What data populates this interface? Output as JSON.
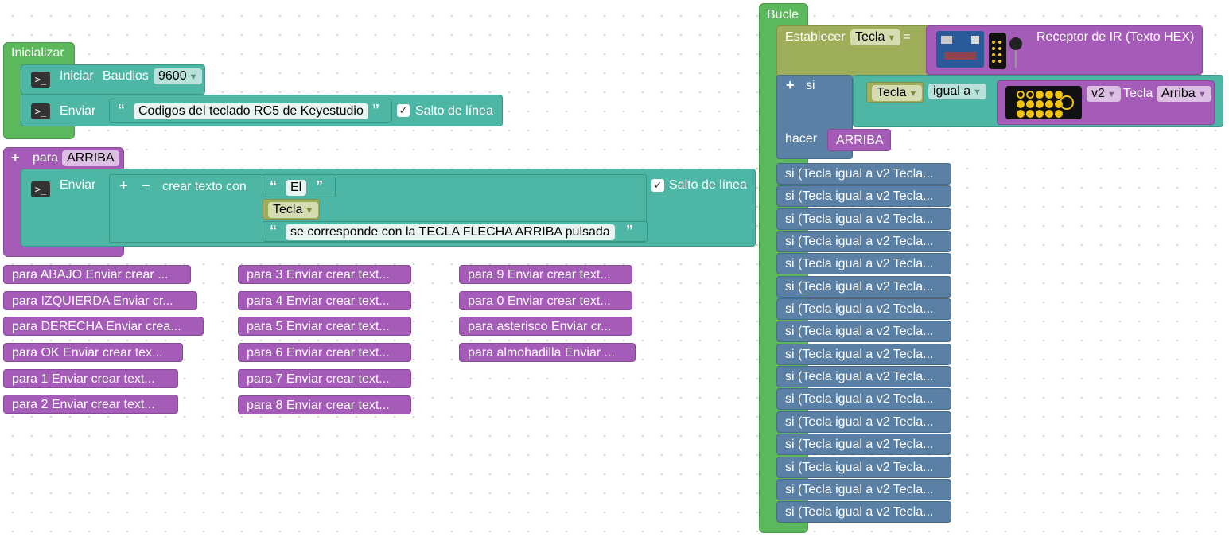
{
  "init_block": {
    "label": "Inicializar",
    "serial_begin": {
      "label": "Iniciar",
      "baud_label": "Baudios",
      "baud_value": "9600"
    },
    "serial_print": {
      "label": "Enviar",
      "text": "Codigos del teclado RC5 de Keyestudio",
      "newline_label": "Salto de línea"
    }
  },
  "func_arriba": {
    "label": "para",
    "name": "ARRIBA",
    "print_label": "Enviar",
    "join_label": "crear texto con",
    "item1": "El",
    "item2_var": "Tecla",
    "item3": "se corresponde con la TECLA FLECHA ARRIBA pulsada",
    "newline_label": "Salto de línea"
  },
  "collapsed_funcs": {
    "col1": [
      "para ABAJO  Enviar   crear ...",
      "para IZQUIERDA  Enviar   cr...",
      "para DERECHA  Enviar   crea...",
      "para OK  Enviar   crear tex...",
      "para 1  Enviar   crear text...",
      "para 2  Enviar   crear text..."
    ],
    "col2": [
      "para 3  Enviar   crear text...",
      "para 4  Enviar   crear text...",
      "para 5  Enviar   crear text...",
      "para 6  Enviar   crear text...",
      "para 7  Enviar   crear text...",
      "para 8  Enviar   crear text..."
    ],
    "col3": [
      "para 9  Enviar   crear text...",
      "para 0  Enviar   crear text...",
      "para asterisco  Enviar   cr...",
      "para almohadilla  Enviar   ..."
    ]
  },
  "loop_block": {
    "label": "Bucle",
    "set_label": "Establecer",
    "set_var": "Tecla",
    "eq": "=",
    "ir_label": "Receptor de IR (Texto HEX)",
    "if_label": "si",
    "do_label": "hacer",
    "cond_var": "Tecla",
    "cond_op": "igual a",
    "remote_version": "v2",
    "remote_key_label": "Tecla",
    "remote_key": "Arriba",
    "call_name": "ARRIBA",
    "collapsed_ifs": [
      "si (Tecla igual a  v2 Tecla...",
      "si (Tecla igual a  v2 Tecla...",
      "si (Tecla igual a  v2 Tecla...",
      "si (Tecla igual a  v2 Tecla...",
      "si (Tecla igual a  v2 Tecla...",
      "si (Tecla igual a  v2 Tecla...",
      "si (Tecla igual a  v2 Tecla...",
      "si (Tecla igual a  v2 Tecla...",
      "si (Tecla igual a  v2 Tecla...",
      "si (Tecla igual a  v2 Tecla...",
      "si (Tecla igual a  v2 Tecla...",
      "si (Tecla igual a  v2 Tecla...",
      "si (Tecla igual a  v2 Tecla...",
      "si (Tecla igual a  v2 Tecla...",
      "si (Tecla igual a  v2 Tecla...",
      "si (Tecla igual a  v2 Tecla..."
    ]
  },
  "colors": {
    "init": "#5cb85c",
    "serial": "#4db6a4",
    "function": "#a55cb8",
    "logic": "#5b80a5",
    "variable": "#9fae5a"
  }
}
